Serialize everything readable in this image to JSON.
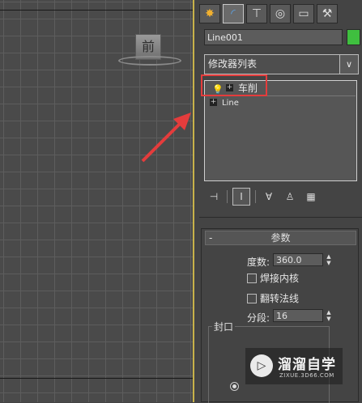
{
  "viewport": {
    "view_label": "前",
    "border_color": "#c8b24a",
    "arrow_color": "#e43c3c"
  },
  "command_panel": {
    "tabs": [
      "create-icon",
      "modify-icon",
      "hierarchy-icon",
      "motion-icon",
      "display-icon",
      "utilities-icon"
    ],
    "active_tab": "modify-icon",
    "object_name": "Line001",
    "object_color": "#3fbf3f",
    "modifier_list_label": "修改器列表",
    "modifier_stack": [
      {
        "label": "车削",
        "selected": true
      },
      {
        "label": "Line",
        "selected": false
      }
    ],
    "highlight_color": "#e43c3c"
  },
  "parameters": {
    "rollout_title": "参数",
    "collapse_symbol": "-",
    "degrees_label": "度数:",
    "degrees_value": "360.0",
    "weld_core_label": "焊接内核",
    "weld_core_checked": false,
    "flip_normals_label": "翻转法线",
    "flip_normals_checked": false,
    "segments_label": "分段:",
    "segments_value": "16",
    "capping_label": "封口"
  },
  "watermark": {
    "title": "溜溜自学",
    "subtitle": "ZIXUE.3D66.COM"
  }
}
